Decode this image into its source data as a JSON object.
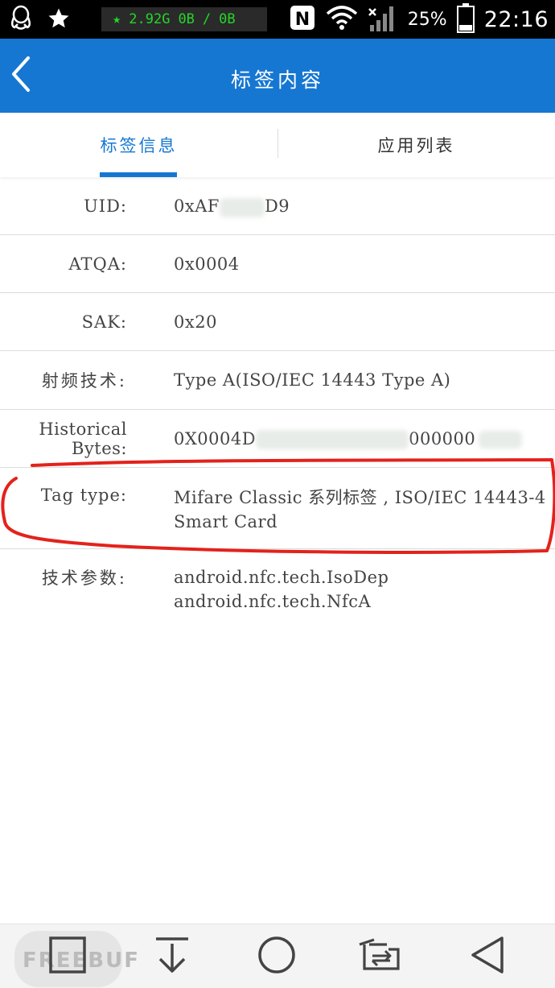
{
  "status_bar": {
    "net_rate": "2.92G",
    "net_up": "0B",
    "net_sep": "/",
    "net_down": "0B",
    "nfc_letter": "N",
    "battery": "25%",
    "time": "22:16"
  },
  "app_bar": {
    "title": "标签内容"
  },
  "tabs": [
    {
      "label": "标签信息",
      "active": true
    },
    {
      "label": "应用列表",
      "active": false
    }
  ],
  "rows": [
    {
      "label": "UID:",
      "value_prefix": "0xAF",
      "value_suffix": "D9"
    },
    {
      "label": "ATQA:",
      "value": "0x0004"
    },
    {
      "label": "SAK:",
      "value": "0x20"
    },
    {
      "label": "射频技术:",
      "value": "Type A(ISO/IEC 14443 Type A)"
    },
    {
      "label": "Historical Bytes:",
      "value_prefix": "0X0004D",
      "value_suffix": "000000"
    },
    {
      "label": "Tag type:",
      "value_line1": "Mifare Classic 系列标签 , ISO/IEC 14443-4",
      "value_line2": "Smart Card"
    },
    {
      "label": "技术参数:",
      "value_line1": "android.nfc.tech.IsoDep",
      "value_line2": "android.nfc.tech.NfcA"
    }
  ],
  "watermark": "FREEBUF",
  "colors": {
    "primary": "#1677d2",
    "highlight_ink": "#e3221c",
    "net_text": "#25d62a"
  },
  "icons": [
    "qq-icon",
    "star-icon",
    "nfc-icon",
    "wifi-icon",
    "signal-icon",
    "battery-icon",
    "back-arrow-icon",
    "recent-apps-icon",
    "download-icon",
    "home-icon",
    "screen-switch-icon",
    "back-triangle-icon"
  ]
}
